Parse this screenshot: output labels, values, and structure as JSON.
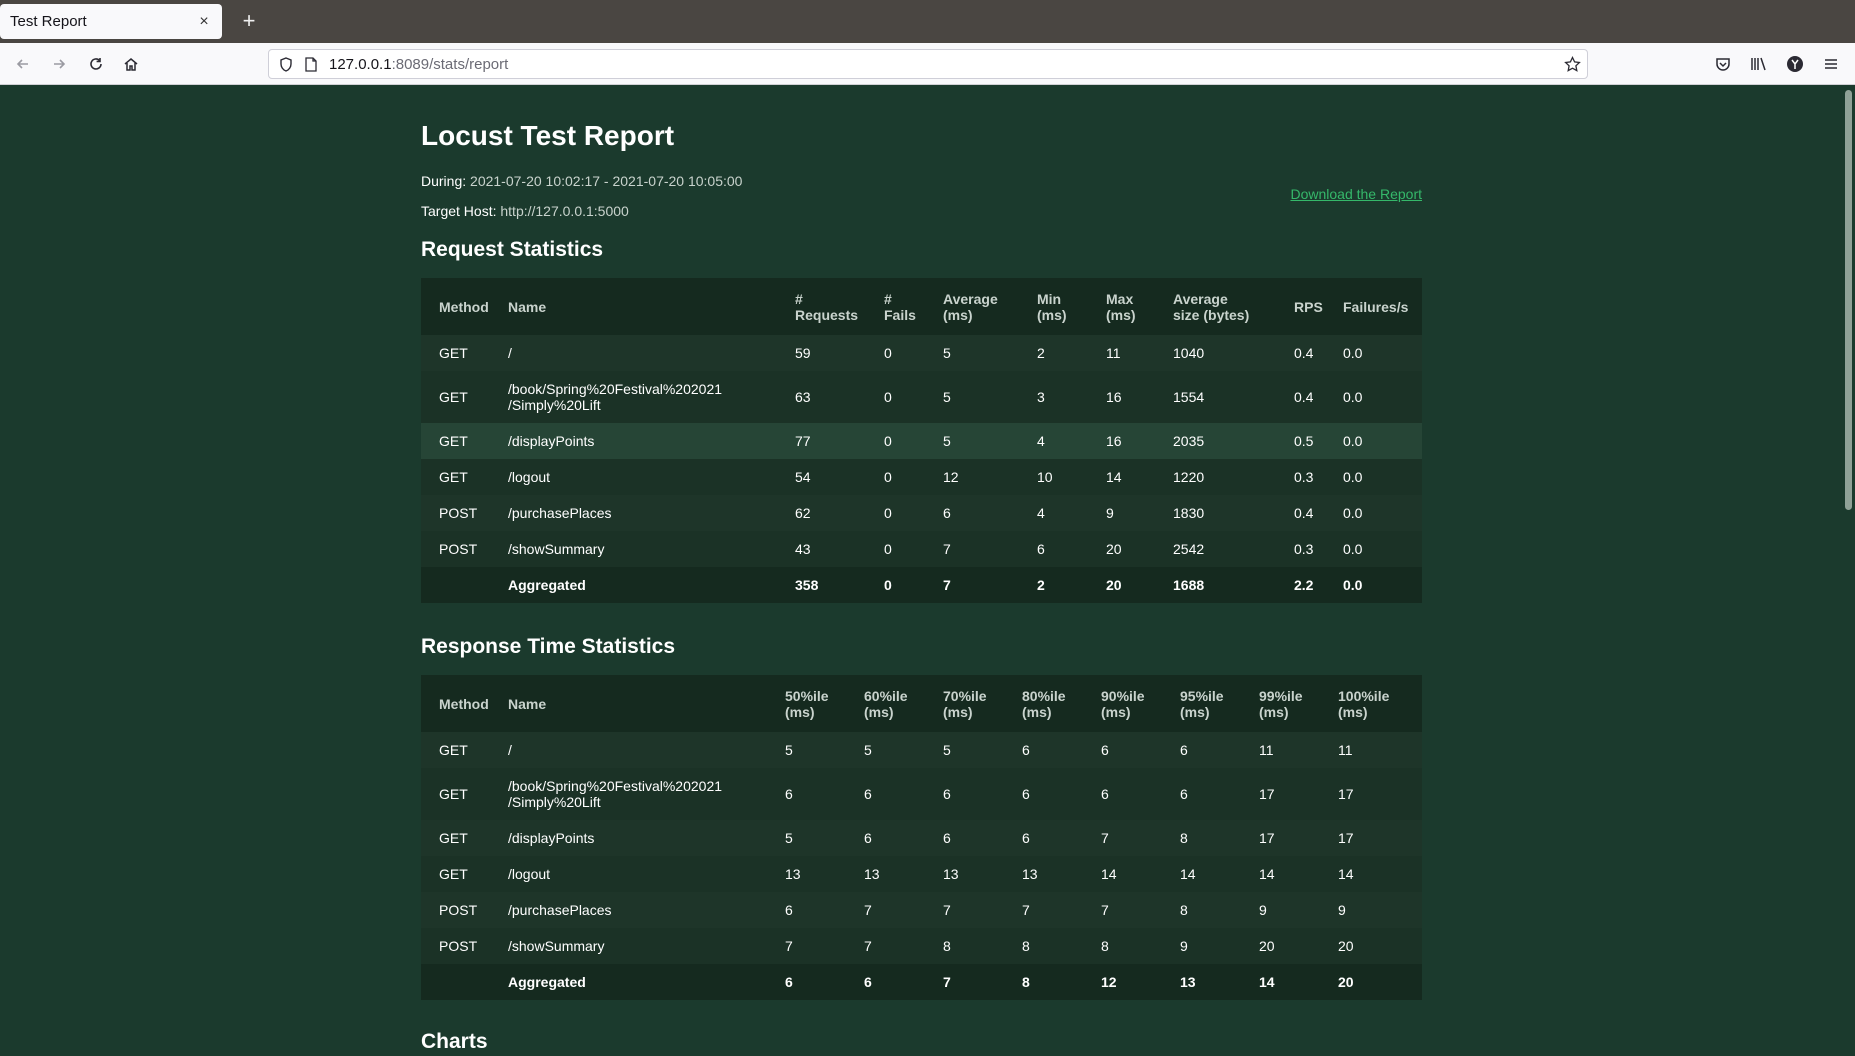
{
  "browser": {
    "tab_title": "Test Report",
    "tab_close": "×",
    "new_tab": "+",
    "url_host": "127.0.0.1",
    "url_rest": ":8089/stats/report"
  },
  "report": {
    "title": "Locust Test Report",
    "during_label": "During:",
    "during_value": "2021-07-20 10:02:17 - 2021-07-20 10:05:00",
    "host_label": "Target Host:",
    "host_value": "http://127.0.0.1:5000",
    "download_label": "Download the Report"
  },
  "request_stats": {
    "title": "Request Statistics",
    "headers": [
      "Method",
      "Name",
      "# Requests",
      "# Fails",
      "Average (ms)",
      "Min (ms)",
      "Max (ms)",
      "Average size (bytes)",
      "RPS",
      "Failures/s"
    ],
    "rows": [
      [
        "GET",
        "/",
        "59",
        "0",
        "5",
        "2",
        "11",
        "1040",
        "0.4",
        "0.0"
      ],
      [
        "GET",
        "/book/Spring%20Festival%202021 /Simply%20Lift",
        "63",
        "0",
        "5",
        "3",
        "16",
        "1554",
        "0.4",
        "0.0"
      ],
      [
        "GET",
        "/displayPoints",
        "77",
        "0",
        "5",
        "4",
        "16",
        "2035",
        "0.5",
        "0.0"
      ],
      [
        "GET",
        "/logout",
        "54",
        "0",
        "12",
        "10",
        "14",
        "1220",
        "0.3",
        "0.0"
      ],
      [
        "POST",
        "/purchasePlaces",
        "62",
        "0",
        "6",
        "4",
        "9",
        "1830",
        "0.4",
        "0.0"
      ],
      [
        "POST",
        "/showSummary",
        "43",
        "0",
        "7",
        "6",
        "20",
        "2542",
        "0.3",
        "0.0"
      ]
    ],
    "footer": [
      "",
      "Aggregated",
      "358",
      "0",
      "7",
      "2",
      "20",
      "1688",
      "2.2",
      "0.0"
    ]
  },
  "response_stats": {
    "title": "Response Time Statistics",
    "headers": [
      "Method",
      "Name",
      "50%ile (ms)",
      "60%ile (ms)",
      "70%ile (ms)",
      "80%ile (ms)",
      "90%ile (ms)",
      "95%ile (ms)",
      "99%ile (ms)",
      "100%ile (ms)"
    ],
    "rows": [
      [
        "GET",
        "/",
        "5",
        "5",
        "5",
        "6",
        "6",
        "6",
        "11",
        "11"
      ],
      [
        "GET",
        "/book/Spring%20Festival%202021 /Simply%20Lift",
        "6",
        "6",
        "6",
        "6",
        "6",
        "6",
        "17",
        "17"
      ],
      [
        "GET",
        "/displayPoints",
        "5",
        "6",
        "6",
        "6",
        "7",
        "8",
        "17",
        "17"
      ],
      [
        "GET",
        "/logout",
        "13",
        "13",
        "13",
        "13",
        "14",
        "14",
        "14",
        "14"
      ],
      [
        "POST",
        "/purchasePlaces",
        "6",
        "7",
        "7",
        "7",
        "7",
        "8",
        "9",
        "9"
      ],
      [
        "POST",
        "/showSummary",
        "7",
        "7",
        "8",
        "8",
        "8",
        "9",
        "20",
        "20"
      ]
    ],
    "footer": [
      "",
      "Aggregated",
      "6",
      "6",
      "7",
      "8",
      "12",
      "13",
      "14",
      "20"
    ]
  },
  "charts": {
    "title": "Charts"
  }
}
